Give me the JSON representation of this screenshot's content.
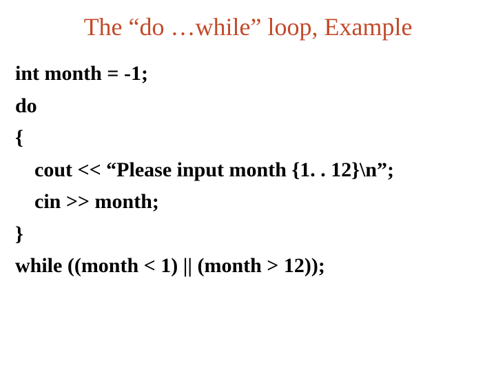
{
  "title": "The “do …while” loop, Example",
  "code": {
    "l1": "int month = -1;",
    "l2": "do",
    "l3": "{",
    "l4": "cout << “Please input month {1. . 12}\\n”;",
    "l5": "cin >> month;",
    "l6": "}",
    "l7": "while ((month < 1) || (month > 12));"
  }
}
